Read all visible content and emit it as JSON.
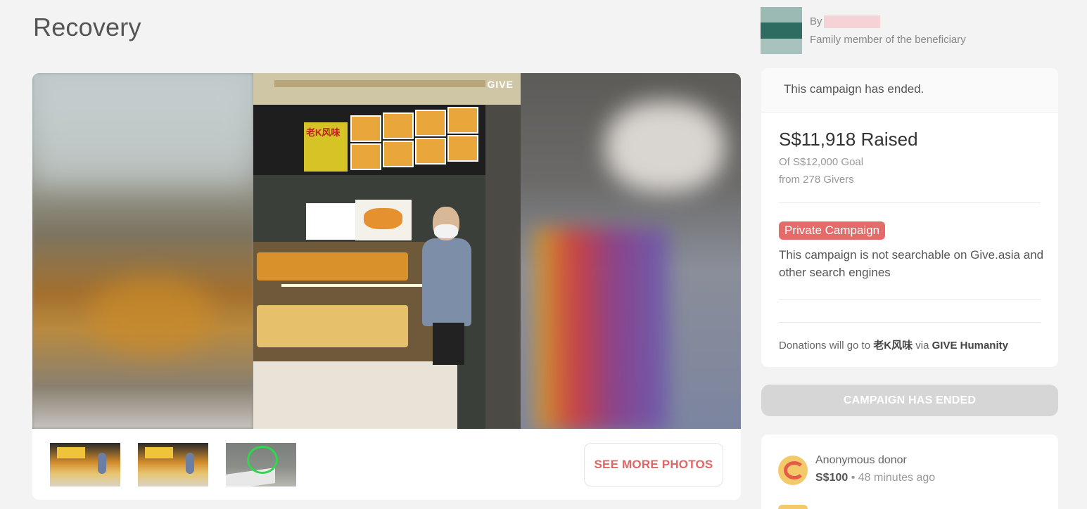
{
  "page": {
    "title": "Recovery"
  },
  "gallery": {
    "watermark": "GIVE",
    "stall_sign": "老K风味",
    "see_more_label": "SEE MORE PHOTOS"
  },
  "organizer": {
    "by_prefix": "By",
    "role": "Family member of the beneficiary"
  },
  "campaign": {
    "status": "This campaign has ended.",
    "raised": "S$11,918 Raised",
    "goal": "Of S$12,000 Goal",
    "givers": "from 278 Givers",
    "private_badge": "Private Campaign",
    "private_desc": "This campaign is not searchable on Give.asia and other search engines",
    "donations_prefix": "Donations will go to",
    "beneficiary": "老K风味",
    "donations_via": "via",
    "platform": "GIVE Humanity"
  },
  "cta": {
    "ended_label": "CAMPAIGN HAS ENDED"
  },
  "donors": [
    {
      "name": "Anonymous donor",
      "amount": "S$100",
      "separator": "•",
      "time": "48 minutes ago"
    }
  ],
  "colors": {
    "accent": "#e56a6a",
    "background": "#f3f3f3",
    "ended_button": "#d6d6d6"
  }
}
